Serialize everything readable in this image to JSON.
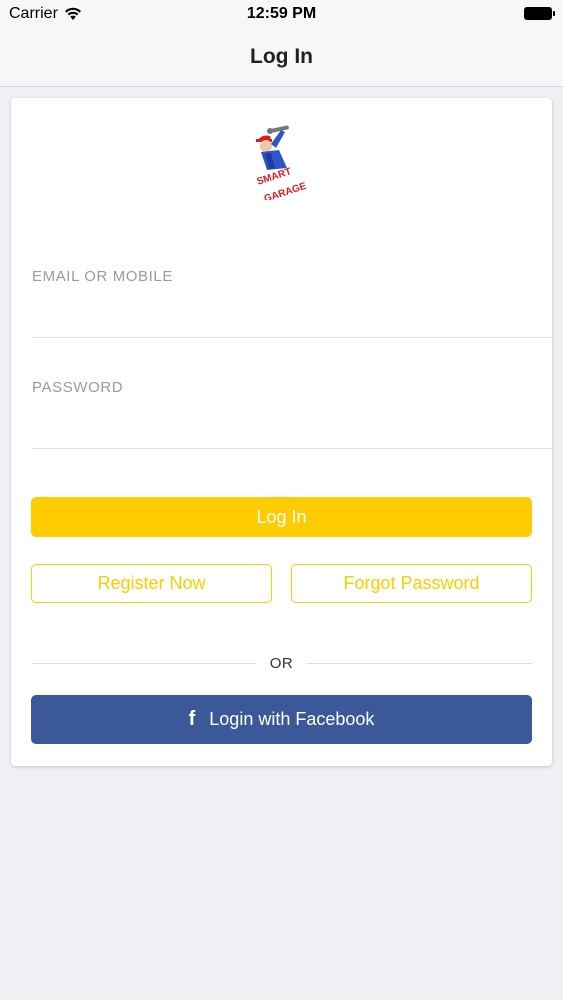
{
  "status_bar": {
    "carrier": "Carrier",
    "time": "12:59 PM",
    "wifi_icon": "wifi-icon",
    "battery_icon": "battery-icon"
  },
  "nav": {
    "title": "Log In"
  },
  "logo": {
    "line1": "SMART",
    "line2": "GARAGE",
    "icon": "mechanic-logo"
  },
  "form": {
    "email_label": "EMAIL OR MOBILE",
    "email_value": "",
    "password_label": "PASSWORD",
    "password_value": ""
  },
  "buttons": {
    "login": "Log In",
    "register": "Register Now",
    "forgot": "Forgot Password",
    "or": "OR",
    "facebook": "Login with Facebook",
    "facebook_icon": "facebook-icon"
  },
  "colors": {
    "accent": "#fecc00",
    "facebook": "#3b5998",
    "label": "#9a9aa0"
  }
}
